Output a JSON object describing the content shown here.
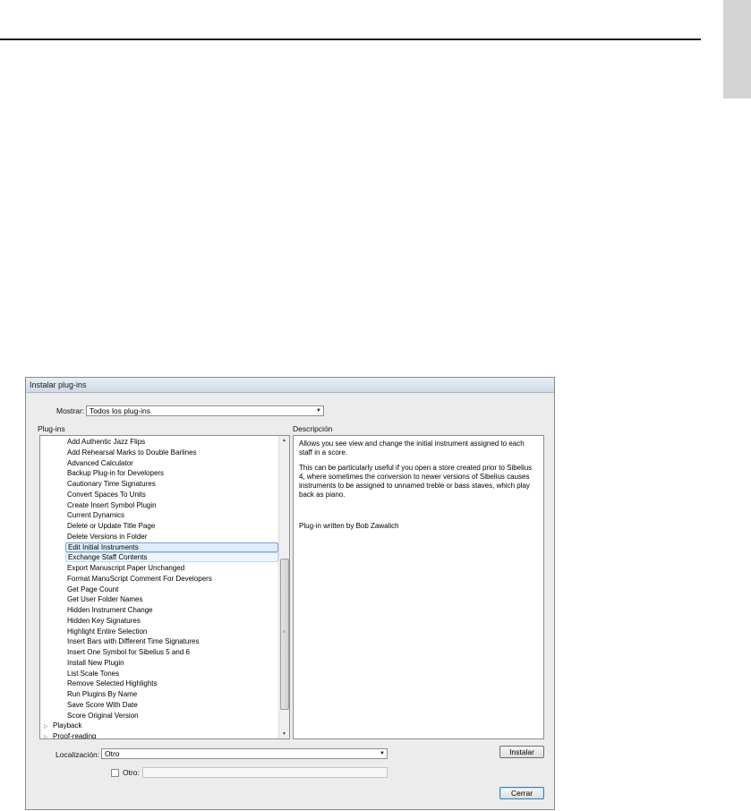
{
  "dialog": {
    "title": "Instalar plug-ins",
    "show_label": "Mostrar:",
    "show_value": "Todos los plug-ins",
    "plugins_header": "Plug-ins",
    "description_header": "Descripción",
    "plugins": [
      "Add Authentic Jazz Flips",
      "Add Rehearsal Marks to Double Barlines",
      "Advanced Calculator",
      "Backup Plug-in for Developers",
      "Cautionary Time Signatures",
      "Convert Spaces To Units",
      "Create Insert Symbol Plugin",
      "Current Dynamics",
      "Delete or Update Title Page",
      "Delete Versions in Folder",
      "Edit Initial Instruments",
      "Exchange Staff Contents",
      "Export Manuscript Paper Unchanged",
      "Format ManuScript Comment For Developers",
      "Get Page Count",
      "Get User Folder Names",
      "Hidden Instrument Change",
      "Hidden Key Signatures",
      "Highlight Entire Selection",
      "Insert Bars with Different Time Signatures",
      "Insert One Symbol for Sibelius 5 and 6",
      "Install New Plugin",
      "List Scale Tones",
      "Remove Selected Highlights",
      "Run Plugins By Name",
      "Save Score With Date",
      "Score Original Version"
    ],
    "selected_plugin": "Edit Initial Instruments",
    "categories": [
      "Playback",
      "Proof-reading"
    ],
    "description": {
      "p1": "Allows you see view and change the initial instrument assigned to each staff in a score.",
      "p2": "This can be particularly useful if you open a store created prior to Sibelius 4, where sometimes the conversion to newer versions of Sibelius causes instruments to be assigned to unnamed treble or bass staves, which play back as piano.",
      "author": "Plug-in written by Bob Zawalich"
    },
    "location_label": "Localización:",
    "location_value": "Otro",
    "other_label": "Otro:",
    "install_button": "Instalar",
    "close_button": "Cerrar"
  }
}
